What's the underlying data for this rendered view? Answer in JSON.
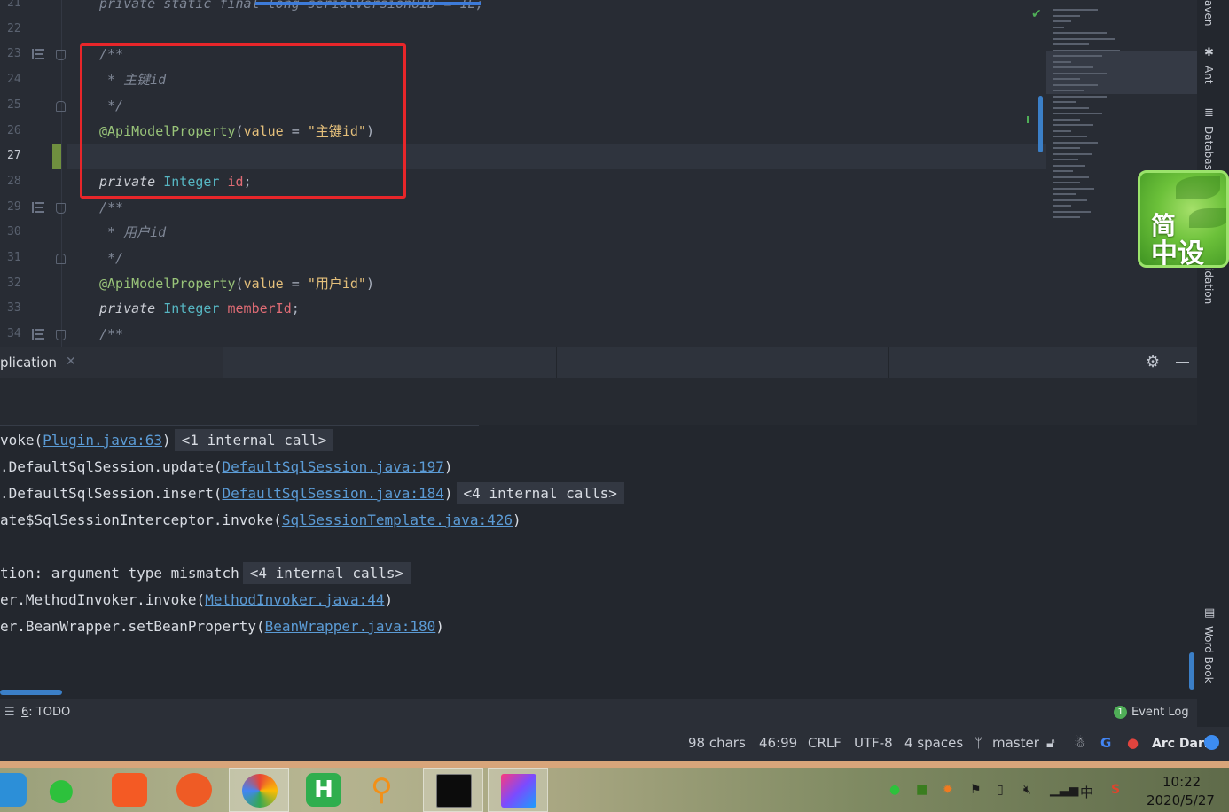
{
  "editor": {
    "lines": [
      {
        "num": "21",
        "text": "private static final long serialVersionUID = 1L;"
      },
      {
        "num": "22",
        "text": ""
      },
      {
        "num": "23",
        "text": "/**"
      },
      {
        "num": "24",
        "text": " * 主键id"
      },
      {
        "num": "25",
        "text": " */"
      },
      {
        "num": "26",
        "ann": "@ApiModelProperty",
        "key": "value",
        "eq": " = ",
        "str": "\"主键id\"",
        "close": ")"
      },
      {
        "num": "27",
        "text": ""
      },
      {
        "num": "28",
        "kw": "private",
        "type": "Integer",
        "field": "id",
        "end": ";"
      },
      {
        "num": "29",
        "text": "/**"
      },
      {
        "num": "30",
        "text": " * 用户id"
      },
      {
        "num": "31",
        "text": " */"
      },
      {
        "num": "32",
        "ann": "@ApiModelProperty",
        "key": "value",
        "eq": " = ",
        "str": "\"用户id\"",
        "close": ")"
      },
      {
        "num": "33",
        "kw": "private",
        "type": "Integer",
        "field": "memberId",
        "end": ";"
      },
      {
        "num": "34",
        "text": "/**"
      }
    ]
  },
  "right_tools": {
    "maven": "aven",
    "ant": "Ant",
    "database": "Databas",
    "validation": "idation",
    "word_book": "Word Book"
  },
  "ime_widget": {
    "line1": "简",
    "line2": "中设"
  },
  "run_panel": {
    "tab_label": "plication",
    "console": [
      {
        "pre": "voke(",
        "link": "Plugin.java:63",
        "post": ")",
        "chip": "<1 internal call>"
      },
      {
        "pre": ".DefaultSqlSession.update(",
        "link": "DefaultSqlSession.java:197",
        "post": ")",
        "chip": ""
      },
      {
        "pre": ".DefaultSqlSession.insert(",
        "link": "DefaultSqlSession.java:184",
        "post": ")",
        "chip": "<4 internal calls>"
      },
      {
        "pre": "ate$SqlSessionInterceptor.invoke(",
        "link": "SqlSessionTemplate.java:426",
        "post": ")",
        "chip": ""
      },
      {
        "pre": "",
        "link": "",
        "post": "",
        "chip": ""
      },
      {
        "pre": "tion: argument type mismatch",
        "link": "",
        "post": "",
        "chip": "<4 internal calls>"
      },
      {
        "pre": "er.MethodInvoker.invoke(",
        "link": "MethodInvoker.java:44",
        "post": ")",
        "chip": ""
      },
      {
        "pre": "er.BeanWrapper.setBeanProperty(",
        "link": "BeanWrapper.java:180",
        "post": ")",
        "chip": ""
      }
    ]
  },
  "tool_windows": {
    "todo_mnemonic": "6",
    "todo_label": ": TODO",
    "event_count": "1",
    "event_label": "Event Log"
  },
  "status_bar": {
    "chars": "98 chars",
    "position": "46:99",
    "line_sep": "CRLF",
    "encoding": "UTF-8",
    "indent": "4 spaces",
    "branch": "master",
    "theme": "Arc Dark"
  },
  "taskbar": {
    "tray_lang": "中",
    "time": "10:22",
    "date": "2020/5/27"
  },
  "colors": {
    "highlight_box": "#e8262a",
    "accent": "#3b7fc7",
    "ok": "#4fae57"
  }
}
